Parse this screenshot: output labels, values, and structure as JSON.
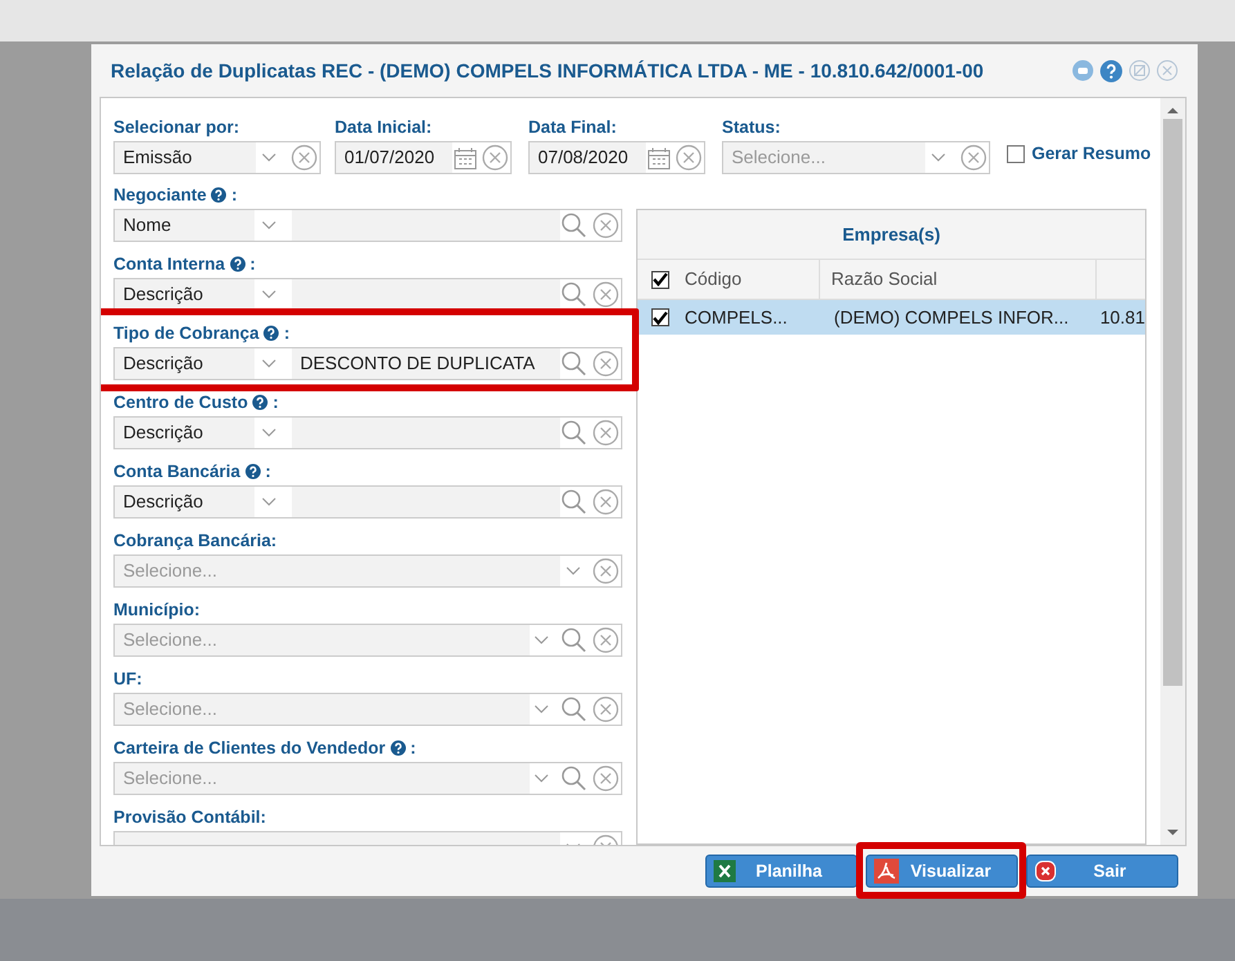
{
  "window": {
    "title": "Relação de Duplicatas REC - (DEMO) COMPELS INFORMÁTICA LTDA - ME - 10.810.642/0001-00"
  },
  "filters": [
    {
      "kind": "select",
      "label": "Selecionar por:",
      "value": "Emissão"
    },
    {
      "kind": "date",
      "label": "Data Inicial:",
      "value": "01/07/2020"
    },
    {
      "kind": "date",
      "label": "Data Final:",
      "value": "07/08/2020"
    },
    {
      "kind": "select",
      "label": "Status:",
      "placeholder": "Selecione..."
    }
  ],
  "gerar_resumo": {
    "label": "Gerar Resumo",
    "checked": false
  },
  "fields": [
    {
      "kind": "lookup",
      "label": "Negociante",
      "help": true,
      "label_end": ":",
      "mode": "Nome",
      "highlighted": false
    },
    {
      "kind": "lookup",
      "label": "Conta Interna",
      "help": true,
      "label_end": ":",
      "mode": "Descrição",
      "highlighted": false
    },
    {
      "kind": "lookup",
      "label": "Tipo de Cobrança",
      "help": true,
      "label_end": ":",
      "mode": "Descrição",
      "value": "DESCONTO DE DUPLICATA",
      "highlighted": true
    },
    {
      "kind": "lookup",
      "label": "Centro de Custo",
      "help": true,
      "label_end": ":",
      "mode": "Descrição",
      "highlighted": false
    },
    {
      "kind": "lookup",
      "label": "Conta Bancária",
      "help": true,
      "label_end": ":",
      "mode": "Descrição",
      "highlighted": false
    },
    {
      "kind": "select",
      "label": "Cobrança Bancária:",
      "help": false,
      "placeholder": "Selecione...",
      "search": false,
      "highlighted": false
    },
    {
      "kind": "select",
      "label": "Município:",
      "help": false,
      "placeholder": "Selecione...",
      "search": true,
      "highlighted": false
    },
    {
      "kind": "select",
      "label": "UF:",
      "help": false,
      "placeholder": "Selecione...",
      "search": true,
      "highlighted": false
    },
    {
      "kind": "select",
      "label": "Carteira de Clientes do Vendedor",
      "help": true,
      "label_end": ":",
      "placeholder": "Selecione...",
      "search": true,
      "highlighted": false
    },
    {
      "kind": "select",
      "label": "Provisão Contábil:",
      "help": false,
      "search": false,
      "highlighted": false
    }
  ],
  "companies": {
    "title": "Empresa(s)",
    "all_checked": true,
    "columns": [
      "Código",
      "Razão Social"
    ],
    "rows": [
      {
        "checked": true,
        "selected": true,
        "cells": [
          "COMPELS...",
          "(DEMO) COMPELS INFOR...",
          "10.81"
        ]
      }
    ]
  },
  "buttons": [
    {
      "kind": "excel",
      "label": "Planilha",
      "highlighted": false
    },
    {
      "kind": "pdf",
      "label": "Visualizar",
      "highlighted": true
    },
    {
      "kind": "exit",
      "label": "Sair",
      "highlighted": false
    }
  ]
}
